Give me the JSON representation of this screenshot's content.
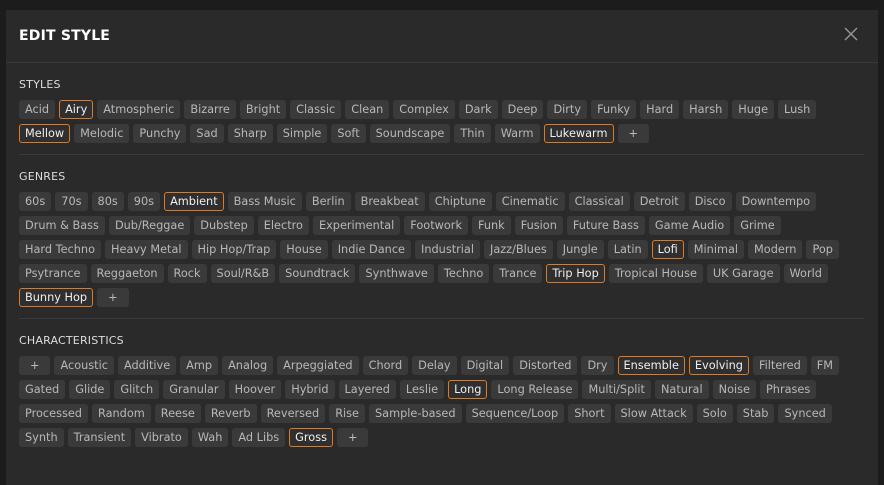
{
  "dialog": {
    "title": "EDIT STYLE",
    "close_icon": "close-icon"
  },
  "accent_color": "#e07a22",
  "sections": [
    {
      "id": "styles",
      "title": "STYLES",
      "tags": [
        {
          "label": "Acid",
          "selected": false
        },
        {
          "label": "Airy",
          "selected": true
        },
        {
          "label": "Atmospheric",
          "selected": false
        },
        {
          "label": "Bizarre",
          "selected": false
        },
        {
          "label": "Bright",
          "selected": false
        },
        {
          "label": "Classic",
          "selected": false
        },
        {
          "label": "Clean",
          "selected": false
        },
        {
          "label": "Complex",
          "selected": false
        },
        {
          "label": "Dark",
          "selected": false
        },
        {
          "label": "Deep",
          "selected": false
        },
        {
          "label": "Dirty",
          "selected": false
        },
        {
          "label": "Funky",
          "selected": false
        },
        {
          "label": "Hard",
          "selected": false
        },
        {
          "label": "Harsh",
          "selected": false
        },
        {
          "label": "Huge",
          "selected": false
        },
        {
          "label": "Lush",
          "selected": false
        },
        {
          "label": "Mellow",
          "selected": true
        },
        {
          "label": "Melodic",
          "selected": false
        },
        {
          "label": "Punchy",
          "selected": false
        },
        {
          "label": "Sad",
          "selected": false
        },
        {
          "label": "Sharp",
          "selected": false
        },
        {
          "label": "Simple",
          "selected": false
        },
        {
          "label": "Soft",
          "selected": false
        },
        {
          "label": "Soundscape",
          "selected": false
        },
        {
          "label": "Thin",
          "selected": false
        },
        {
          "label": "Warm",
          "selected": false
        },
        {
          "label": "Lukewarm",
          "selected": true
        },
        {
          "label": "+",
          "selected": false,
          "add": true
        }
      ]
    },
    {
      "id": "genres",
      "title": "GENRES",
      "tags": [
        {
          "label": "60s",
          "selected": false
        },
        {
          "label": "70s",
          "selected": false
        },
        {
          "label": "80s",
          "selected": false
        },
        {
          "label": "90s",
          "selected": false
        },
        {
          "label": "Ambient",
          "selected": true
        },
        {
          "label": "Bass Music",
          "selected": false
        },
        {
          "label": "Berlin",
          "selected": false
        },
        {
          "label": "Breakbeat",
          "selected": false
        },
        {
          "label": "Chiptune",
          "selected": false
        },
        {
          "label": "Cinematic",
          "selected": false
        },
        {
          "label": "Classical",
          "selected": false
        },
        {
          "label": "Detroit",
          "selected": false
        },
        {
          "label": "Disco",
          "selected": false
        },
        {
          "label": "Downtempo",
          "selected": false
        },
        {
          "label": "Drum & Bass",
          "selected": false
        },
        {
          "label": "Dub/Reggae",
          "selected": false
        },
        {
          "label": "Dubstep",
          "selected": false
        },
        {
          "label": "Electro",
          "selected": false
        },
        {
          "label": "Experimental",
          "selected": false
        },
        {
          "label": "Footwork",
          "selected": false
        },
        {
          "label": "Funk",
          "selected": false
        },
        {
          "label": "Fusion",
          "selected": false
        },
        {
          "label": "Future Bass",
          "selected": false
        },
        {
          "label": "Game Audio",
          "selected": false
        },
        {
          "label": "Grime",
          "selected": false
        },
        {
          "label": "Hard Techno",
          "selected": false
        },
        {
          "label": "Heavy Metal",
          "selected": false
        },
        {
          "label": "Hip Hop/Trap",
          "selected": false
        },
        {
          "label": "House",
          "selected": false
        },
        {
          "label": "Indie Dance",
          "selected": false
        },
        {
          "label": "Industrial",
          "selected": false
        },
        {
          "label": "Jazz/Blues",
          "selected": false
        },
        {
          "label": "Jungle",
          "selected": false
        },
        {
          "label": "Latin",
          "selected": false
        },
        {
          "label": "Lofi",
          "selected": true
        },
        {
          "label": "Minimal",
          "selected": false
        },
        {
          "label": "Modern",
          "selected": false
        },
        {
          "label": "Pop",
          "selected": false
        },
        {
          "label": "Psytrance",
          "selected": false
        },
        {
          "label": "Reggaeton",
          "selected": false
        },
        {
          "label": "Rock",
          "selected": false
        },
        {
          "label": "Soul/R&B",
          "selected": false
        },
        {
          "label": "Soundtrack",
          "selected": false
        },
        {
          "label": "Synthwave",
          "selected": false
        },
        {
          "label": "Techno",
          "selected": false
        },
        {
          "label": "Trance",
          "selected": false
        },
        {
          "label": "Trip Hop",
          "selected": true
        },
        {
          "label": "Tropical House",
          "selected": false
        },
        {
          "label": "UK Garage",
          "selected": false
        },
        {
          "label": "World",
          "selected": false
        },
        {
          "label": "Bunny Hop",
          "selected": true
        },
        {
          "label": "+",
          "selected": false,
          "add": true
        }
      ]
    },
    {
      "id": "characteristics",
      "title": "CHARACTERISTICS",
      "tags": [
        {
          "label": "+",
          "selected": false,
          "add": true
        },
        {
          "label": "Acoustic",
          "selected": false
        },
        {
          "label": "Additive",
          "selected": false
        },
        {
          "label": "Amp",
          "selected": false
        },
        {
          "label": "Analog",
          "selected": false
        },
        {
          "label": "Arpeggiated",
          "selected": false
        },
        {
          "label": "Chord",
          "selected": false
        },
        {
          "label": "Delay",
          "selected": false
        },
        {
          "label": "Digital",
          "selected": false
        },
        {
          "label": "Distorted",
          "selected": false
        },
        {
          "label": "Dry",
          "selected": false
        },
        {
          "label": "Ensemble",
          "selected": true
        },
        {
          "label": "Evolving",
          "selected": true
        },
        {
          "label": "Filtered",
          "selected": false
        },
        {
          "label": "FM",
          "selected": false
        },
        {
          "label": "Gated",
          "selected": false
        },
        {
          "label": "Glide",
          "selected": false
        },
        {
          "label": "Glitch",
          "selected": false
        },
        {
          "label": "Granular",
          "selected": false
        },
        {
          "label": "Hoover",
          "selected": false
        },
        {
          "label": "Hybrid",
          "selected": false
        },
        {
          "label": "Layered",
          "selected": false
        },
        {
          "label": "Leslie",
          "selected": false
        },
        {
          "label": "Long",
          "selected": true
        },
        {
          "label": "Long Release",
          "selected": false
        },
        {
          "label": "Multi/Split",
          "selected": false
        },
        {
          "label": "Natural",
          "selected": false
        },
        {
          "label": "Noise",
          "selected": false
        },
        {
          "label": "Phrases",
          "selected": false
        },
        {
          "label": "Processed",
          "selected": false
        },
        {
          "label": "Random",
          "selected": false
        },
        {
          "label": "Reese",
          "selected": false
        },
        {
          "label": "Reverb",
          "selected": false
        },
        {
          "label": "Reversed",
          "selected": false
        },
        {
          "label": "Rise",
          "selected": false
        },
        {
          "label": "Sample-based",
          "selected": false
        },
        {
          "label": "Sequence/Loop",
          "selected": false
        },
        {
          "label": "Short",
          "selected": false
        },
        {
          "label": "Slow Attack",
          "selected": false
        },
        {
          "label": "Solo",
          "selected": false
        },
        {
          "label": "Stab",
          "selected": false
        },
        {
          "label": "Synced",
          "selected": false
        },
        {
          "label": "Synth",
          "selected": false
        },
        {
          "label": "Transient",
          "selected": false
        },
        {
          "label": "Vibrato",
          "selected": false
        },
        {
          "label": "Wah",
          "selected": false
        },
        {
          "label": "Ad Libs",
          "selected": false
        },
        {
          "label": "Gross",
          "selected": true
        },
        {
          "label": "+",
          "selected": false,
          "add": true
        }
      ]
    }
  ]
}
